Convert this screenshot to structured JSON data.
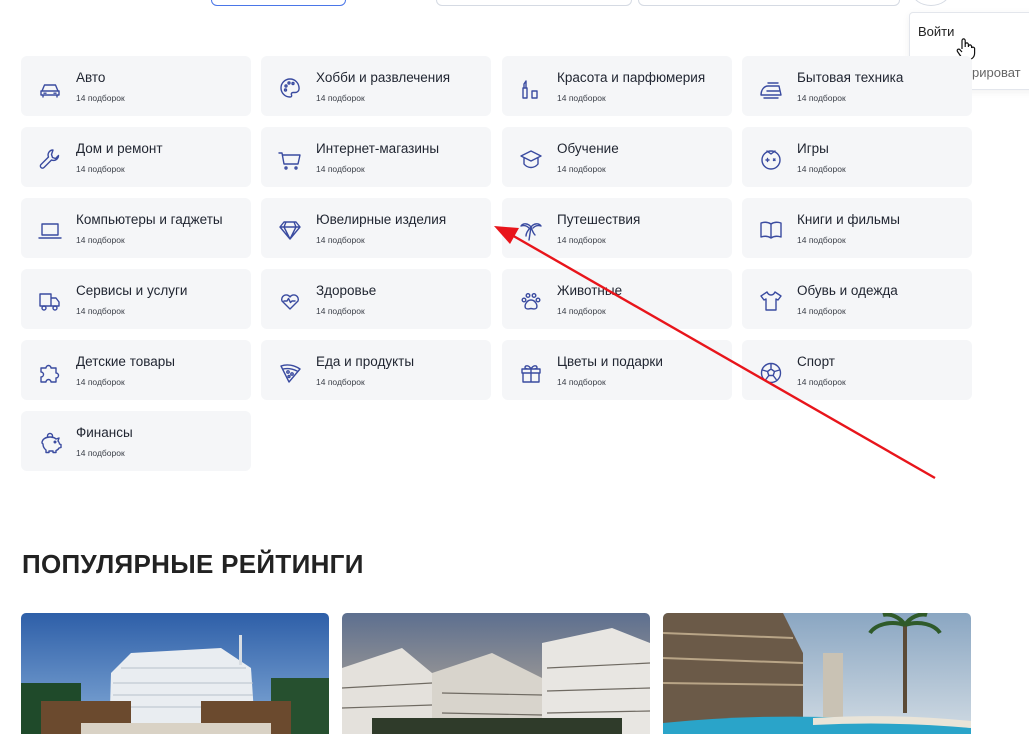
{
  "dropdown": {
    "login": "Войти",
    "register": "Зарегистрироват"
  },
  "categories": [
    {
      "title": "Авто",
      "sub": "14 подборок",
      "icon": "car-icon"
    },
    {
      "title": "Хобби и развлечения",
      "sub": "14 подборок",
      "icon": "palette-icon"
    },
    {
      "title": "Красота и парфюмерия",
      "sub": "14 подборок",
      "icon": "lipstick-icon"
    },
    {
      "title": "Бытовая техника",
      "sub": "14 подборок",
      "icon": "iron-icon"
    },
    {
      "title": "Дом и ремонт",
      "sub": "14 подборок",
      "icon": "wrench-icon"
    },
    {
      "title": "Интернет-магазины",
      "sub": "14 подборок",
      "icon": "cart-icon"
    },
    {
      "title": "Обучение",
      "sub": "14 подборок",
      "icon": "graduation-cap-icon"
    },
    {
      "title": "Игры",
      "sub": "14 подборок",
      "icon": "gamepad-icon"
    },
    {
      "title": "Компьютеры и гаджеты",
      "sub": "14 подборок",
      "icon": "laptop-icon"
    },
    {
      "title": "Ювелирные изделия",
      "sub": "14 подборок",
      "icon": "diamond-icon"
    },
    {
      "title": "Путешествия",
      "sub": "14 подборок",
      "icon": "palm-tree-icon"
    },
    {
      "title": "Книги и фильмы",
      "sub": "14 подборок",
      "icon": "book-icon"
    },
    {
      "title": "Сервисы и услуги",
      "sub": "14 подборок",
      "icon": "truck-icon"
    },
    {
      "title": "Здоровье",
      "sub": "14 подборок",
      "icon": "heart-pulse-icon"
    },
    {
      "title": "Животные",
      "sub": "14 подборок",
      "icon": "paw-icon"
    },
    {
      "title": "Обувь и одежда",
      "sub": "14 подборок",
      "icon": "tshirt-icon"
    },
    {
      "title": "Детские товары",
      "sub": "14 подборок",
      "icon": "puzzle-icon"
    },
    {
      "title": "Еда и продукты",
      "sub": "14 подборок",
      "icon": "pizza-icon"
    },
    {
      "title": "Цветы и подарки",
      "sub": "14 подборок",
      "icon": "gift-icon"
    },
    {
      "title": "Спорт",
      "sub": "14 подборок",
      "icon": "ball-icon"
    },
    {
      "title": "Финансы",
      "sub": "14 подборок",
      "icon": "piggy-bank-icon"
    }
  ],
  "section": {
    "title": "ПОПУЛЯРНЫЕ РЕЙТИНГИ"
  },
  "colors": {
    "card_bg": "#f5f6f8",
    "icon": "#3a4ba0",
    "annotation_arrow": "#e8151b"
  }
}
